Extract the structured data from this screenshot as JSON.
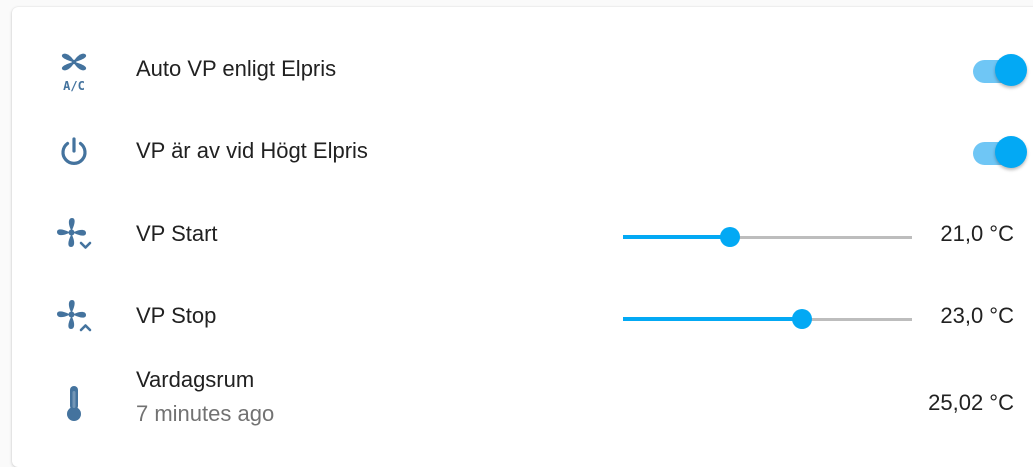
{
  "colors": {
    "icon": "#44739e",
    "accent": "#03a9f4",
    "toggle_track": "#6fc6f5",
    "slider_rail": "#bdbdbd",
    "primary_text": "#212121",
    "secondary_text": "#727272"
  },
  "rows": [
    {
      "icon": "air-conditioner-icon",
      "label": "Auto VP enligt Elpris",
      "state": "on"
    },
    {
      "icon": "power-icon",
      "label": "VP är av vid Högt Elpris",
      "state": "on"
    },
    {
      "icon": "fan-chevron-down-icon",
      "label": "VP Start",
      "value": "21,0 °C",
      "slider_fraction": 0.37
    },
    {
      "icon": "fan-chevron-up-icon",
      "label": "VP Stop",
      "value": "23,0 °C",
      "slider_fraction": 0.62
    },
    {
      "icon": "thermometer-icon",
      "label": "Vardagsrum",
      "secondary": "7 minutes ago",
      "value": "25,02 °C"
    }
  ]
}
